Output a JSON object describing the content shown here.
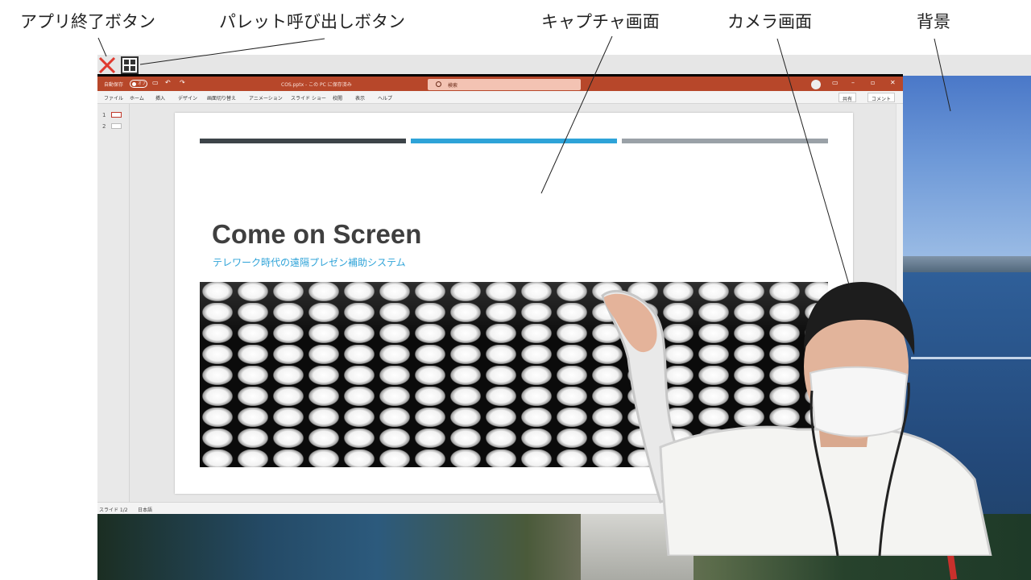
{
  "annotations": {
    "exit_button": "アプリ終了ボタン",
    "palette_button": "パレット呼び出しボタン",
    "capture_screen": "キャプチャ画面",
    "camera_screen": "カメラ画面",
    "background": "背景"
  },
  "app_buttons": {
    "exit_icon": "close-x-icon",
    "palette_icon": "grid-icon",
    "exit_color": "#e03a2f"
  },
  "ppt": {
    "title_bar": {
      "autosave_label": "自動保存",
      "autosave_state": "オフ",
      "file_title": "COS.pptx - この PC に保存済み",
      "search_placeholder": "検索",
      "color": "#b7472a"
    },
    "menu": [
      "ファイル",
      "ホーム",
      "挿入",
      "デザイン",
      "画面切り替え",
      "アニメーション",
      "スライド ショー",
      "校閲",
      "表示",
      "ヘルプ"
    ],
    "share_label": "共有",
    "comment_label": "コメント",
    "thumbnails": [
      "1",
      "2"
    ],
    "status": {
      "slide_count": "スライド 1/2",
      "language": "日本語"
    }
  },
  "slide": {
    "title": "Come on Screen",
    "subtitle": "テレワーク時代の遠隔プレゼン補助システム",
    "bar_colors": [
      "#3d4449",
      "#2ea3d8",
      "#9aa1a7"
    ]
  }
}
